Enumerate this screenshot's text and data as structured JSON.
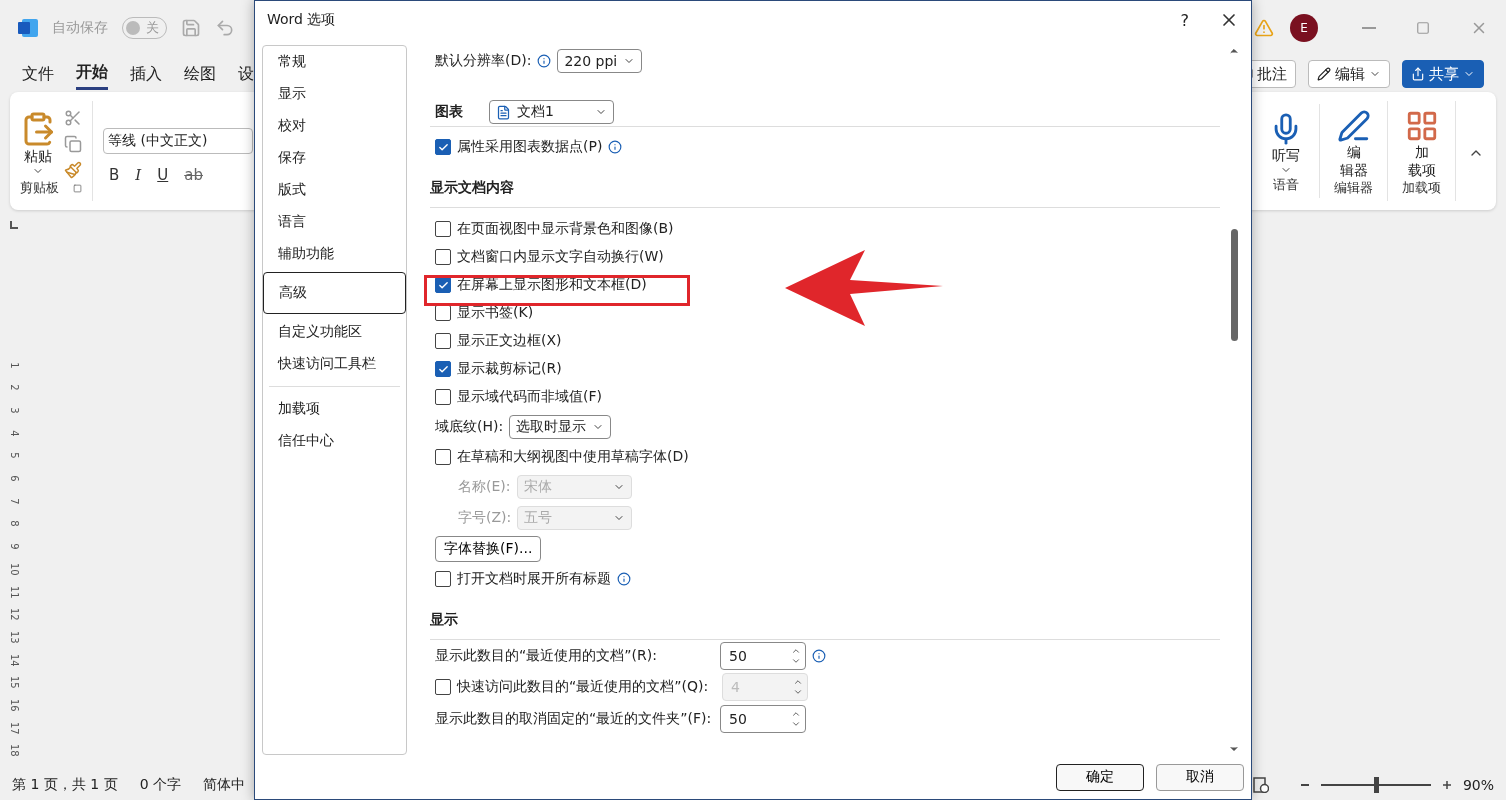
{
  "app": {
    "autosave_label": "自动保存",
    "autosave_toggle": {
      "label": "关",
      "on": false
    },
    "avatar": "E"
  },
  "ribbon_tabs": [
    {
      "label": "文件",
      "selected": false
    },
    {
      "label": "开始",
      "selected": true
    },
    {
      "label": "插入",
      "selected": false
    },
    {
      "label": "绘图",
      "selected": false
    },
    {
      "label": "设",
      "selected": false
    }
  ],
  "header_buttons": [
    {
      "label": "批注",
      "kind": "comment"
    },
    {
      "label": "编辑",
      "kind": "edit"
    },
    {
      "label": "共享",
      "kind": "share"
    }
  ],
  "ribbon_left": {
    "paste_label": "粘贴",
    "clipboard_group": "剪贴板",
    "font_name": "等线 (中文正文)",
    "format_buttons": [
      "B",
      "I",
      "U",
      "ab"
    ]
  },
  "ribbon_right_groups": [
    {
      "label": "语音",
      "command": {
        "kind": "mic",
        "lines": [
          "听写"
        ],
        "dropdown": true
      }
    },
    {
      "label": "编辑器",
      "command": {
        "kind": "editor",
        "lines": [
          "编",
          "辑器"
        ],
        "dropdown": false
      }
    },
    {
      "label": "加载项",
      "command": {
        "kind": "addins",
        "lines": [
          "加",
          "载项"
        ],
        "dropdown": false
      }
    }
  ],
  "ruler_numbers": [
    "1",
    "2",
    "3",
    "4",
    "5",
    "6",
    "7",
    "8",
    "9",
    "10",
    "11",
    "12",
    "13",
    "14",
    "15",
    "16",
    "17",
    "18"
  ],
  "status_bar": {
    "page": "第 1 页，共 1 页",
    "words": "0 个字",
    "language": "简体中",
    "zoom": "90%",
    "zoom_slider": {
      "level": 0.5
    }
  },
  "dialog": {
    "title": "Word 选项",
    "help": "?",
    "nav_groups": [
      [
        {
          "label": "常规",
          "selected": false
        },
        {
          "label": "显示",
          "selected": false
        },
        {
          "label": "校对",
          "selected": false
        },
        {
          "label": "保存",
          "selected": false
        },
        {
          "label": "版式",
          "selected": false
        },
        {
          "label": "语言",
          "selected": false
        },
        {
          "label": "辅助功能",
          "selected": false
        },
        {
          "label": "高级",
          "selected": true
        },
        {
          "label": "自定义功能区",
          "selected": false
        },
        {
          "label": "快速访问工具栏",
          "selected": false
        }
      ],
      [
        {
          "label": "加载项",
          "selected": false
        },
        {
          "label": "信任中心",
          "selected": false
        }
      ]
    ],
    "content": [
      {
        "kind": "select",
        "label": "默认分辨率(D):",
        "info": true,
        "value": "220 ppi"
      },
      {
        "kind": "doc_select",
        "label": "图表",
        "value": "文档1"
      },
      {
        "kind": "checkbox",
        "label": "属性采用图表数据点(P)",
        "checked": true,
        "info": true
      },
      {
        "kind": "heading",
        "label": "显示文档内容"
      },
      {
        "kind": "checkbox",
        "label": "在页面视图中显示背景色和图像(B)",
        "checked": false
      },
      {
        "kind": "checkbox",
        "label": "文档窗口内显示文字自动换行(W)",
        "checked": false
      },
      {
        "kind": "checkbox",
        "label": "在屏幕上显示图形和文本框(D)",
        "checked": true,
        "highlighted": true
      },
      {
        "kind": "checkbox",
        "label": "显示书签(K)",
        "checked": false
      },
      {
        "kind": "checkbox",
        "label": "显示正文边框(X)",
        "checked": false
      },
      {
        "kind": "checkbox",
        "label": "显示裁剪标记(R)",
        "checked": true
      },
      {
        "kind": "checkbox",
        "label": "显示域代码而非域值(F)",
        "checked": false
      },
      {
        "kind": "select",
        "label": "域底纹(H):",
        "value": "选取时显示"
      },
      {
        "kind": "checkbox",
        "label": "在草稿和大纲视图中使用草稿字体(D)",
        "checked": false,
        "children": [
          {
            "kind": "select",
            "label": "名称(E):",
            "value": "宋体",
            "disabled": true
          },
          {
            "kind": "select",
            "label": "字号(Z):",
            "value": "五号",
            "disabled": true
          }
        ]
      },
      {
        "kind": "button",
        "label": "字体替换(F)..."
      },
      {
        "kind": "checkbox",
        "label": "打开文档时展开所有标题",
        "checked": false,
        "info": true
      },
      {
        "kind": "heading",
        "label": "显示"
      },
      {
        "kind": "spin",
        "label": "显示此数目的“最近使用的文档”(R):",
        "value": "50",
        "info": true
      },
      {
        "kind": "check_spin",
        "label": "快速访问此数目的“最近使用的文档”(Q):",
        "checked": false,
        "value": "4",
        "disabled": true
      },
      {
        "kind": "spin",
        "label": "显示此数目的取消固定的“最近的文件夹”(F):",
        "value": "50"
      }
    ],
    "buttons": [
      "确定",
      "取消"
    ]
  }
}
